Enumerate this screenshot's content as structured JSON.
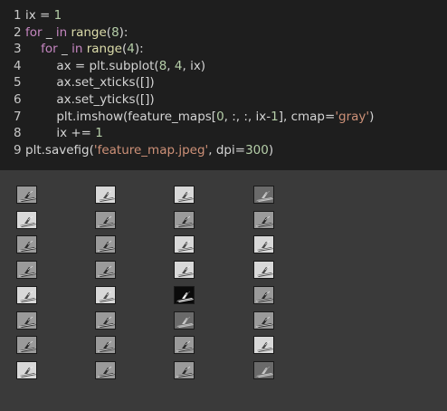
{
  "code_lines": [
    {
      "num": "1",
      "tokens": [
        {
          "t": "ix = ",
          "c": ""
        },
        {
          "t": "1",
          "c": "num"
        }
      ]
    },
    {
      "num": "2",
      "tokens": [
        {
          "t": "for",
          "c": "kw"
        },
        {
          "t": " _ ",
          "c": ""
        },
        {
          "t": "in",
          "c": "kw"
        },
        {
          "t": " ",
          "c": ""
        },
        {
          "t": "range",
          "c": "fn"
        },
        {
          "t": "(",
          "c": ""
        },
        {
          "t": "8",
          "c": "num"
        },
        {
          "t": "):",
          "c": ""
        }
      ]
    },
    {
      "num": "3",
      "tokens": [
        {
          "t": "    ",
          "c": ""
        },
        {
          "t": "for",
          "c": "kw"
        },
        {
          "t": " _ ",
          "c": ""
        },
        {
          "t": "in",
          "c": "kw"
        },
        {
          "t": " ",
          "c": ""
        },
        {
          "t": "range",
          "c": "fn"
        },
        {
          "t": "(",
          "c": ""
        },
        {
          "t": "4",
          "c": "num"
        },
        {
          "t": "):",
          "c": ""
        }
      ]
    },
    {
      "num": "4",
      "tokens": [
        {
          "t": "        ax = plt.subplot(",
          "c": ""
        },
        {
          "t": "8",
          "c": "num"
        },
        {
          "t": ", ",
          "c": ""
        },
        {
          "t": "4",
          "c": "num"
        },
        {
          "t": ", ix)",
          "c": ""
        }
      ]
    },
    {
      "num": "5",
      "tokens": [
        {
          "t": "        ax.set_xticks([])",
          "c": ""
        }
      ]
    },
    {
      "num": "6",
      "tokens": [
        {
          "t": "        ax.set_yticks([])",
          "c": ""
        }
      ]
    },
    {
      "num": "7",
      "tokens": [
        {
          "t": "        plt.imshow(feature_maps[",
          "c": ""
        },
        {
          "t": "0",
          "c": "num"
        },
        {
          "t": ", :, :, ix-",
          "c": ""
        },
        {
          "t": "1",
          "c": "num"
        },
        {
          "t": "], cmap=",
          "c": ""
        },
        {
          "t": "'gray'",
          "c": "str"
        },
        {
          "t": ")",
          "c": ""
        }
      ]
    },
    {
      "num": "8",
      "tokens": [
        {
          "t": "        ix += ",
          "c": ""
        },
        {
          "t": "1",
          "c": "num"
        }
      ]
    },
    {
      "num": "9",
      "tokens": [
        {
          "t": "plt.savefig(",
          "c": ""
        },
        {
          "t": "'feature_map.jpeg'",
          "c": "str"
        },
        {
          "t": ", dpi=",
          "c": ""
        },
        {
          "t": "300",
          "c": "num"
        },
        {
          "t": ")",
          "c": ""
        }
      ]
    }
  ],
  "figure": {
    "rows": 8,
    "cols": 4,
    "thumbs": [
      "mid",
      "light",
      "light",
      "dark",
      "light",
      "mid",
      "mid",
      "mid",
      "mid",
      "mid",
      "light",
      "light",
      "mid",
      "mid",
      "light",
      "light",
      "light",
      "light",
      "black",
      "mid",
      "mid",
      "mid",
      "dark",
      "mid",
      "mid",
      "mid",
      "mid",
      "light",
      "light",
      "mid",
      "mid",
      "dark"
    ]
  },
  "colors": {
    "editor_bg": "#1e1e1e",
    "output_bg": "#3a3a3a",
    "keyword": "#c586c0",
    "number": "#b5cea8",
    "string": "#ce9178",
    "function": "#dcdcaa"
  }
}
